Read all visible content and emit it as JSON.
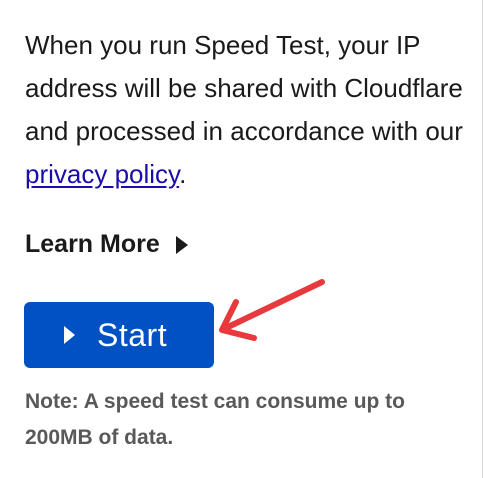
{
  "disclaimer": {
    "text_before_link": "When you run Speed Test, your IP address will be shared with Cloudflare and processed in accordance with our ",
    "link_text": "privacy policy",
    "text_after_link": "."
  },
  "learn_more": {
    "label": "Learn More",
    "icon": "caret-right-icon"
  },
  "start_button": {
    "label": "Start",
    "icon": "play-icon",
    "color": "#0051c3"
  },
  "annotation": {
    "icon": "red-arrow-icon",
    "color": "#e8393d"
  },
  "note": {
    "text": "Note: A speed test can consume up to 200MB of data."
  }
}
